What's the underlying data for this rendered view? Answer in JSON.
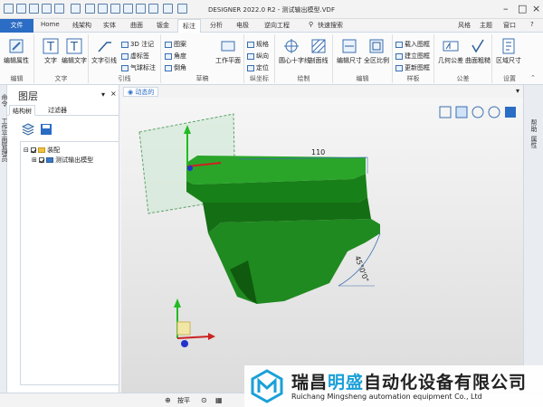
{
  "window": {
    "title": "DESIGNER 2022.0 R2 - 测试输出模型.VDF"
  },
  "menu": {
    "file": "文件",
    "tabs": [
      "Home",
      "线架构",
      "实体",
      "曲面",
      "钣金",
      "标注",
      "分析",
      "电极",
      "逆向工程"
    ],
    "active_tab": "标注",
    "search": "快速搜索",
    "right": [
      "风格",
      "主题",
      "窗口"
    ]
  },
  "ribbon": {
    "edit_group": {
      "label": "编辑",
      "btn": "编辑属性"
    },
    "text_group": {
      "label": "文字",
      "btns": [
        "文字",
        "编辑文字"
      ]
    },
    "leader_group": {
      "label": "引线",
      "btn": "文字引线",
      "small": [
        "3D 注记",
        "虚标签",
        "气球标注"
      ]
    },
    "sketch_group": {
      "label": "草稿",
      "small": [
        "图案",
        "角度",
        "倒角"
      ],
      "btn": "工作平面"
    },
    "axis_group": {
      "label": "纵坐标",
      "small": [
        "规格",
        "纵向",
        "定位"
      ]
    },
    "draw_group": {
      "label": "绘制",
      "btns": [
        "圆心十字线",
        "剖面线"
      ]
    },
    "edit2_group": {
      "label": "编辑",
      "btns": [
        "编辑尺寸",
        "全区比例"
      ]
    },
    "style_group": {
      "label": "样板",
      "small": [
        "载入图框",
        "建立图框",
        "更新图框"
      ]
    },
    "tol_group": {
      "label": "公差",
      "btns": [
        "几何公差",
        "曲面粗糙"
      ]
    },
    "settings_group": {
      "label": "设置",
      "btn": "区域尺寸"
    }
  },
  "left_strip": {
    "text": "命令",
    "text2": "工作平面管理员"
  },
  "panel": {
    "title": "图层",
    "tabs": [
      "结构树",
      "过滤器"
    ],
    "tree": {
      "root": "装配",
      "child": "测试输出模型"
    }
  },
  "viewport": {
    "tab": "动态的",
    "dim_length": "110",
    "dim_angle": "45°0'0\""
  },
  "right_strip": {
    "items": [
      "帮助",
      "属性"
    ]
  },
  "status": {
    "text": "按平"
  },
  "watermark": {
    "title_a": "瑞昌",
    "title_b": "明盛",
    "title_c": "自动化设备有限公司",
    "sub": "Ruichang Mingsheng automation equipment Co., Ltd",
    "brand_color": "#1aa0d8"
  },
  "colors": {
    "accent": "#2b6cc4",
    "model": "#1f8a1f"
  }
}
